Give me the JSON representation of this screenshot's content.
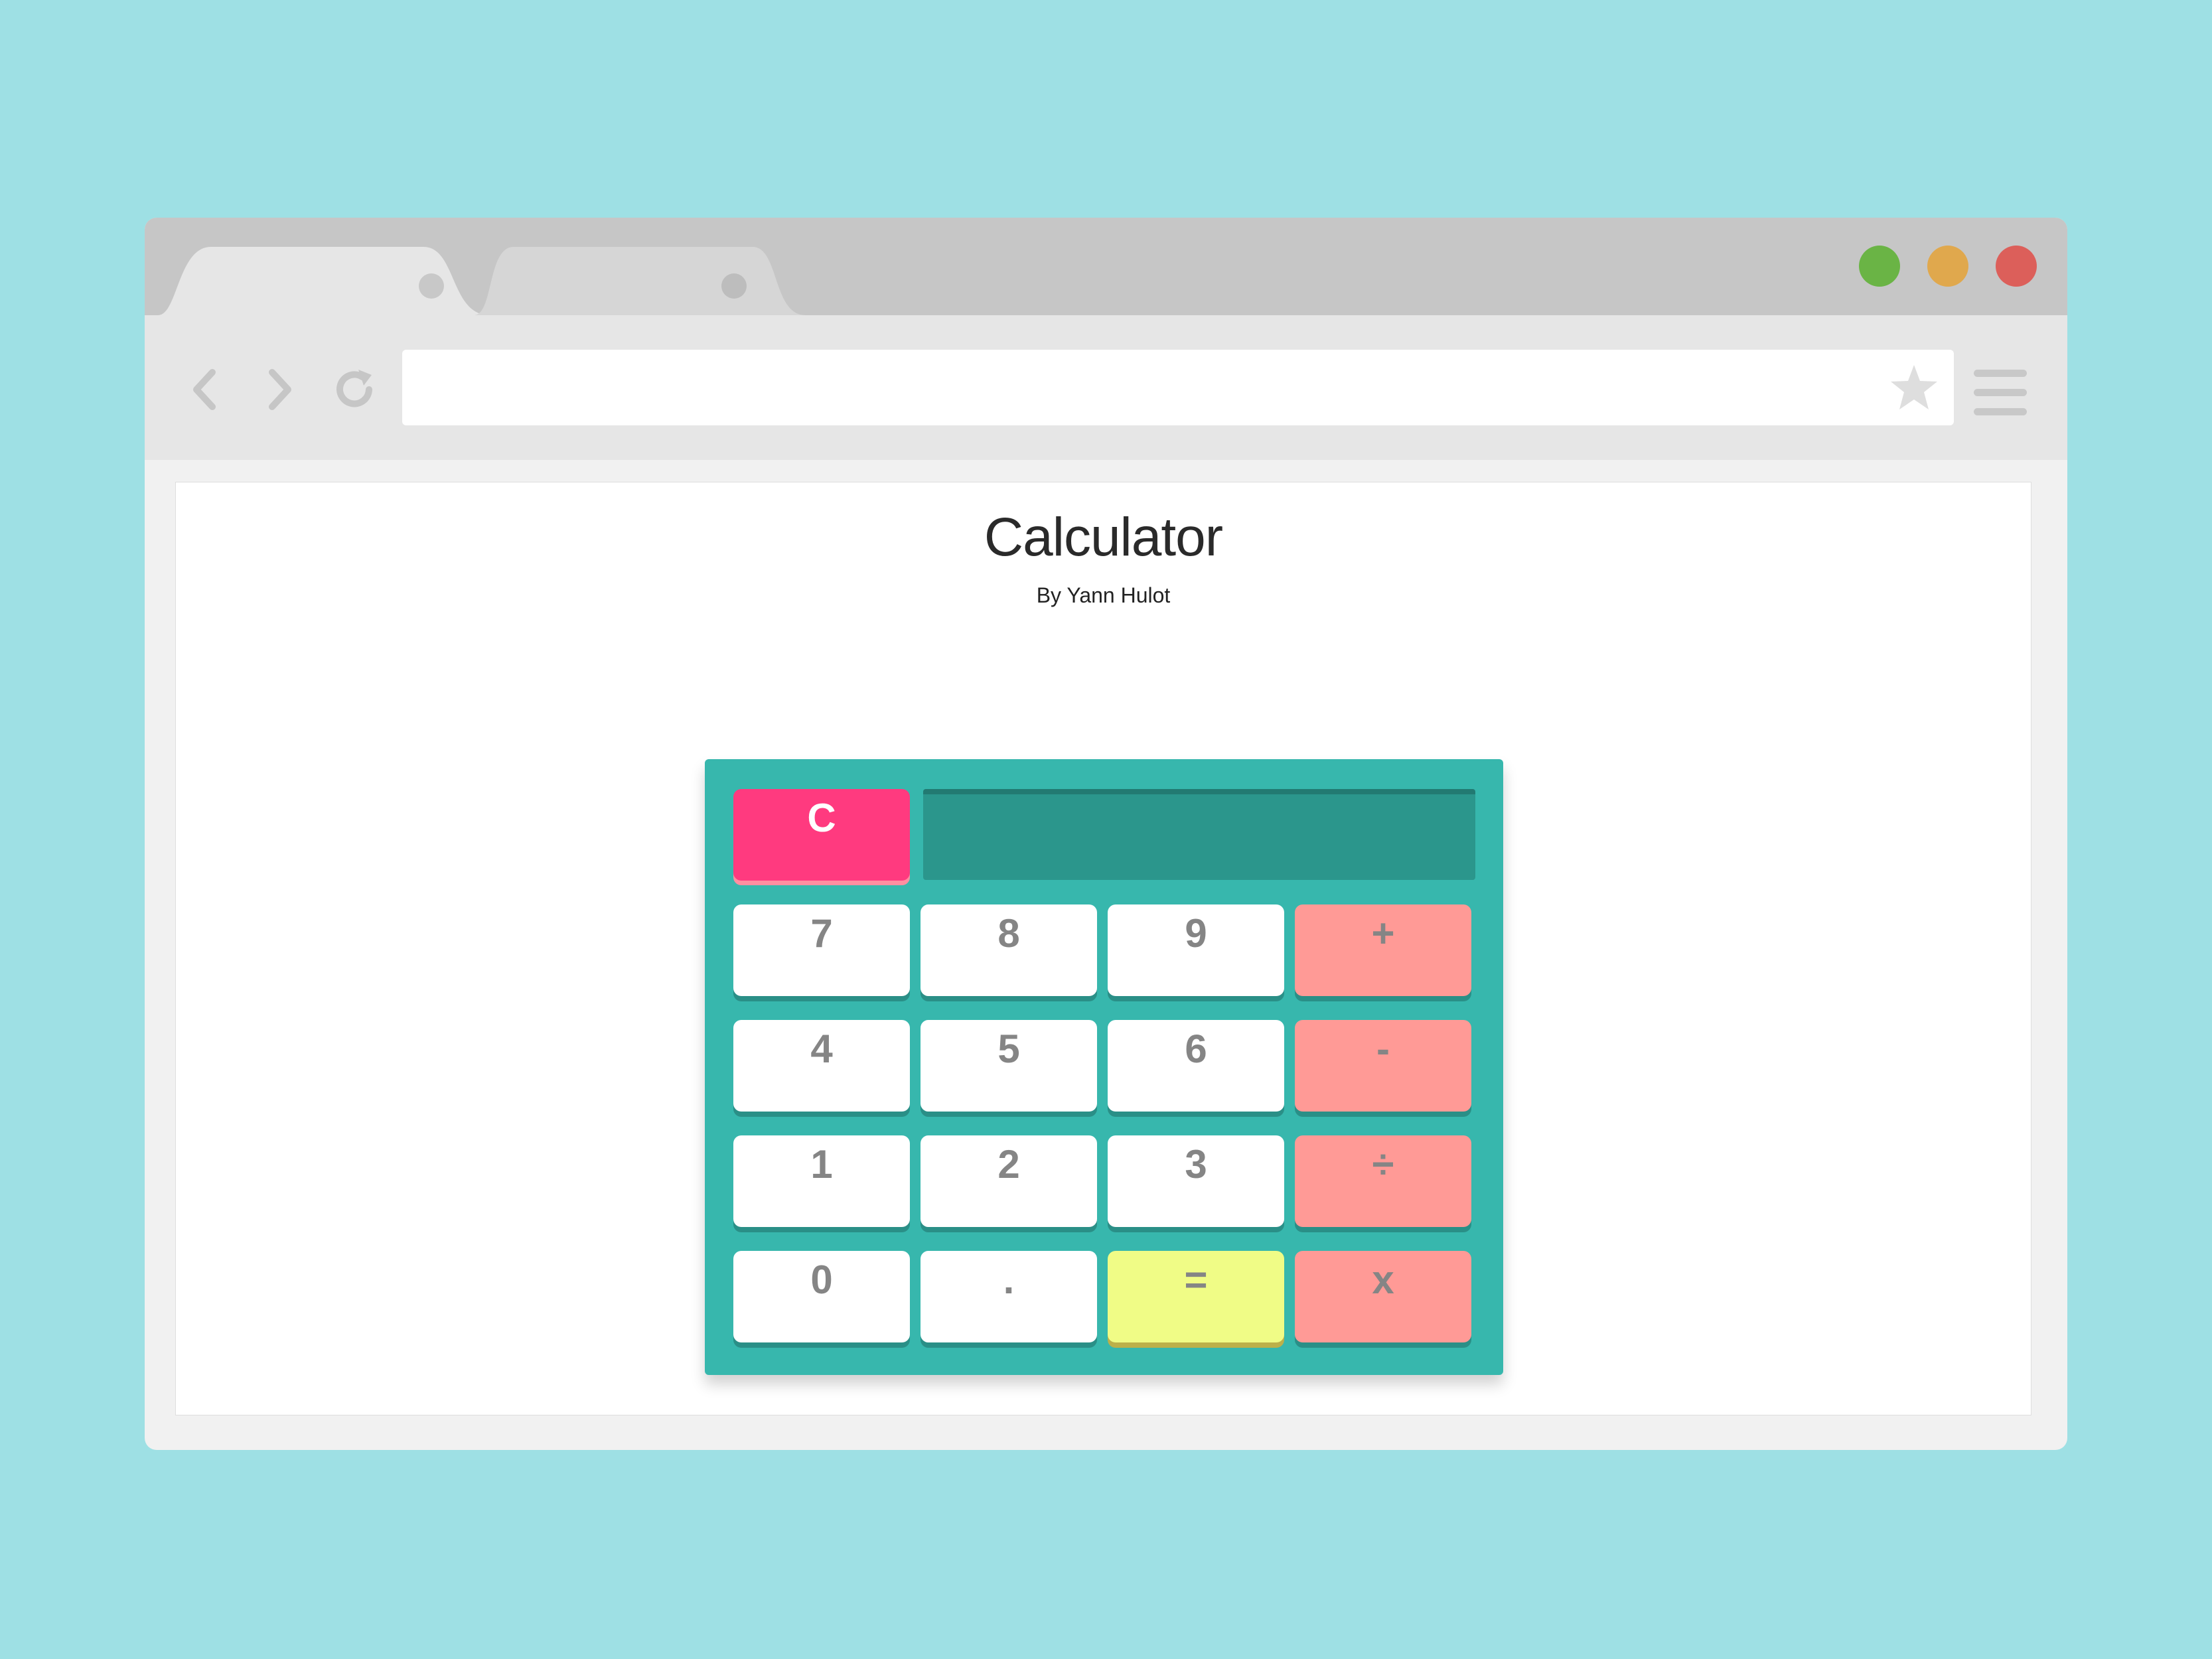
{
  "browser": {
    "tabs": [
      {
        "label": ""
      },
      {
        "label": ""
      }
    ],
    "window_buttons": [
      {
        "name": "maximize",
        "color": "#6ab445"
      },
      {
        "name": "minimize",
        "color": "#e0a84d"
      },
      {
        "name": "close",
        "color": "#dc5f5a"
      }
    ],
    "address_bar": {
      "value": "",
      "placeholder": ""
    },
    "icons": [
      "back-arrow-icon",
      "forward-arrow-icon",
      "reload-icon",
      "star-icon",
      "hamburger-menu-icon"
    ]
  },
  "page": {
    "title": "Calculator",
    "subtitle": "By Yann Hulot"
  },
  "calculator": {
    "display_value": "",
    "clear_label": "C",
    "keys": [
      [
        "7",
        "8",
        "9",
        "+"
      ],
      [
        "4",
        "5",
        "6",
        "-"
      ],
      [
        "1",
        "2",
        "3",
        "÷"
      ],
      [
        "0",
        ".",
        "=",
        "x"
      ]
    ],
    "colors": {
      "body": "#37b7ad",
      "display": "#2b968c",
      "clear": "#ff3a7f",
      "number_key": "#ffffff",
      "operator_key": "#ff9a96",
      "equals_key": "#f0fc86"
    }
  }
}
